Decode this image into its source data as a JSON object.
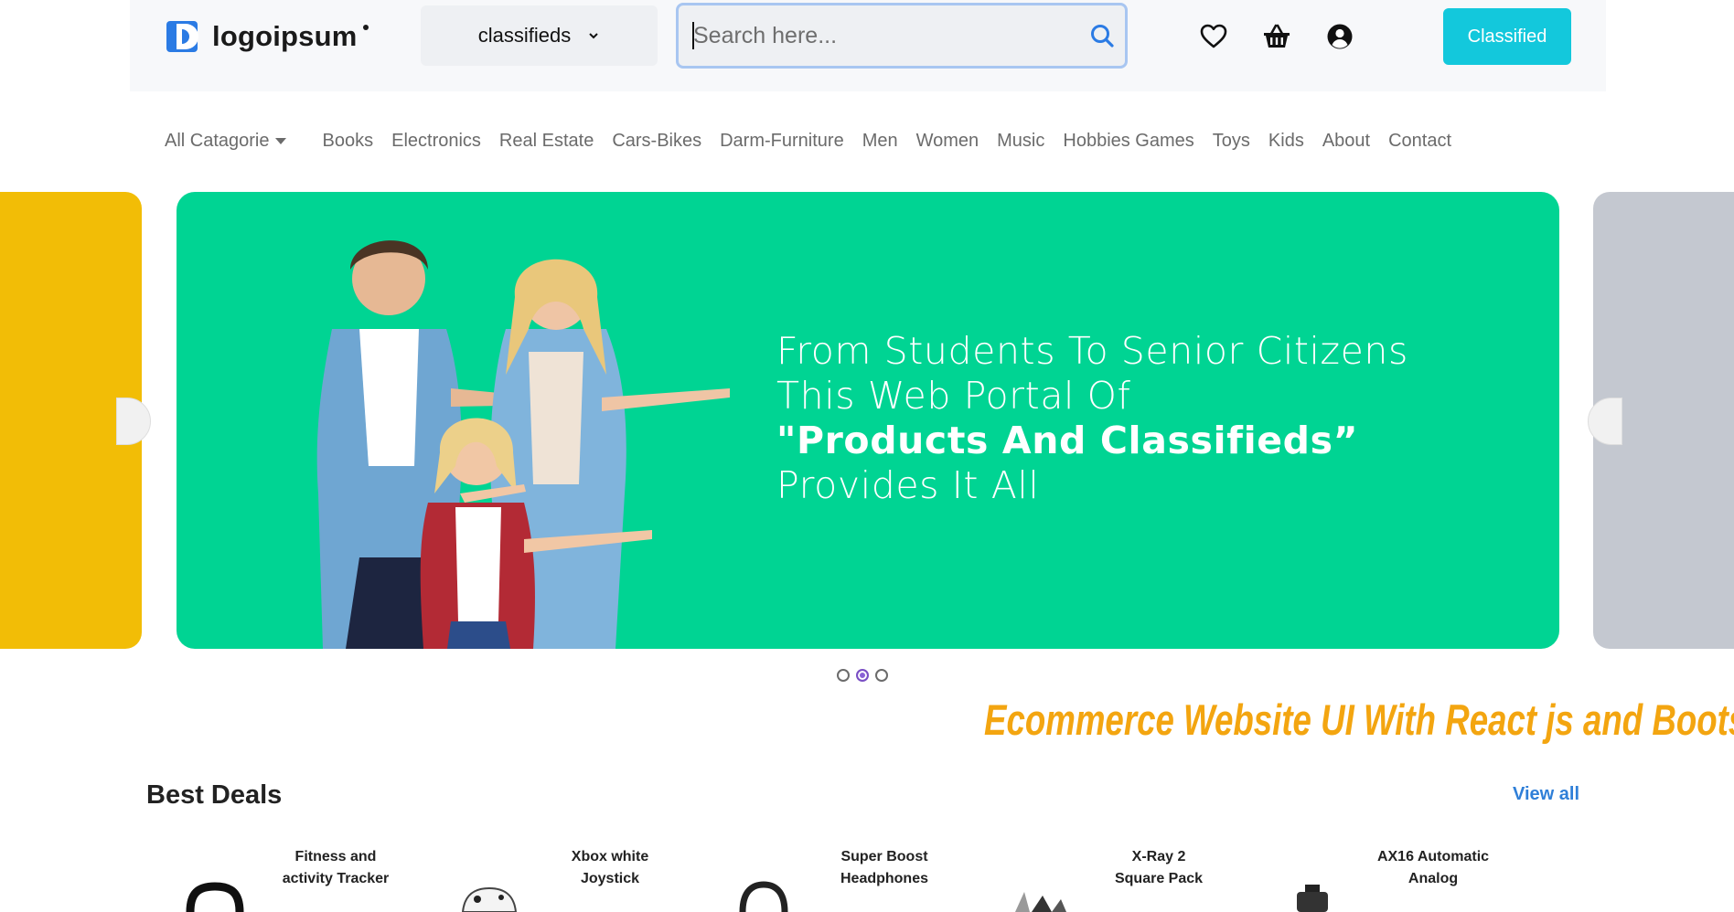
{
  "header": {
    "logo_text": "logoipsum",
    "category_select": {
      "value": "classifieds"
    },
    "search": {
      "placeholder": "Search here..."
    },
    "icons": [
      "heart-icon",
      "basket-icon",
      "user-icon"
    ],
    "cta_label": "Classified",
    "cta_color": "#13c8dc"
  },
  "nav": {
    "all_categories": "All Catagorie",
    "items": [
      "Books",
      "Electronics",
      "Real Estate",
      "Cars-Bikes",
      "Darm-Furniture",
      "Men",
      "Women",
      "Music",
      "Hobbies Games",
      "Toys",
      "Kids",
      "About",
      "Contact"
    ]
  },
  "carousel": {
    "slide_color": "#00d493",
    "prev_color": "#f2bd06",
    "next_color": "#c4c8d0",
    "lines": [
      "From Students To Senior Citizens",
      "This Web Portal Of",
      "\"Products And Classifieds”",
      "Provides It All"
    ],
    "slide_count": 3,
    "active_index": 1
  },
  "watermark": "Ecommerce Website UI With React js and Bootstrap",
  "best_deals": {
    "title": "Best Deals",
    "view_all": "View all",
    "products": [
      {
        "name_1": "Fitness and",
        "name_2": "activity Tracker"
      },
      {
        "name_1": "Xbox white",
        "name_2": "Joystick"
      },
      {
        "name_1": "Super Boost",
        "name_2": "Headphones"
      },
      {
        "name_1": "X-Ray 2",
        "name_2": "Square Pack"
      },
      {
        "name_1": "AX16 Automatic",
        "name_2": "Analog"
      }
    ]
  }
}
